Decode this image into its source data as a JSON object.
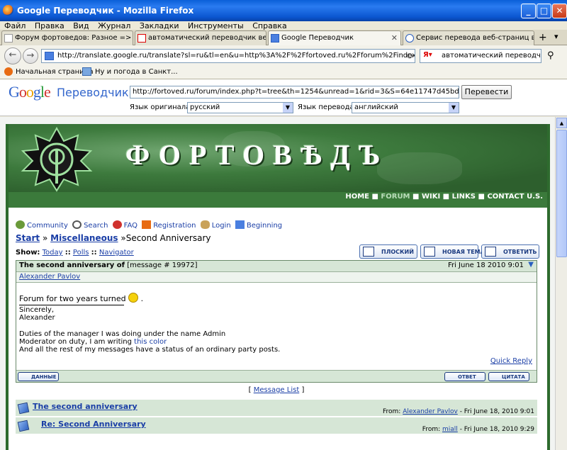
{
  "window": {
    "title": "Google Переводчик - Mozilla Firefox",
    "min": "_",
    "max": "□",
    "close": "✕"
  },
  "menu": [
    "Файл",
    "Правка",
    "Вид",
    "Журнал",
    "Закладки",
    "Инструменты",
    "Справка"
  ],
  "tabs": [
    {
      "label": "Форум фортоведов: Разное => Вт..."
    },
    {
      "label": "автоматический переводчик веб ..."
    },
    {
      "label": "Google Переводчик"
    },
    {
      "label": "Сервис перевода веб-страниц в п..."
    }
  ],
  "new_tab": "+",
  "tab_list": "▾",
  "nav": {
    "back": "←",
    "forward": "→",
    "url": "http://translate.google.ru/translate?sl=ru&tl=en&u=http%3A%2F%2Ffortoved.ru%2Fforum%2Findex.php%3Ft",
    "search_text": "автоматический переводчик",
    "reload": "⟳"
  },
  "bookmarks": [
    "Начальная страница",
    "Ну и погода в Санкт..."
  ],
  "translate_bar": {
    "logo": "Google",
    "service": "Переводчик",
    "url": "http://fortoved.ru/forum/index.php?t=tree&th=1254&unread=1&rid=3&S=64e11747d45bd4e3c8ebc",
    "button": "Перевести",
    "source_label": "Язык оригинала:",
    "source_value": "русский",
    "target_label": "Язык перевода:",
    "target_value": "английский"
  },
  "site": {
    "title": "ФОРТОВѢДЪ",
    "nav": [
      "HOME",
      "FORUM",
      "WIKI",
      "LINKS",
      "CONTACT U.S."
    ],
    "tools": [
      "Community",
      "Search",
      "FAQ",
      "Registration",
      "Login",
      "Beginning"
    ],
    "breadcrumb": {
      "start": "Start",
      "sep1": "»",
      "section": "Miscellaneous",
      "sep2": "»",
      "current": "Second Anniversary"
    },
    "show": {
      "label": "Show:",
      "items": [
        "Today",
        "Polls",
        "Navigator"
      ],
      "sep": "::"
    },
    "actions": [
      "ПЛОСКИЙ",
      "НОВАЯ ТЕМА",
      "ОТВЕТИТЬ"
    ],
    "message": {
      "subject": "The second anniversary of",
      "number": "[message # 19972]",
      "date": "Fri June 18 2010 9:01",
      "author": "Alexander Pavlov",
      "line1": "Forum for two years turned",
      "line1_end": ".",
      "line2": "Sincerely,",
      "line3": "Alexander",
      "line4": "Duties of the manager I was doing under the name Admin",
      "line5_pre": "Moderator on duty, I am writing",
      "line5_link": "this color",
      "line6": "And all the rest of my messages have a status of an ordinary party posts.",
      "quick_reply": "Quick Reply",
      "btn_data": "ДАННЫЕ",
      "btn_reply": "ОТВЕТ",
      "btn_quote": "ЦИТАТА"
    },
    "message_list": {
      "open": "[",
      "link": "Message List",
      "close": "]"
    },
    "list": [
      {
        "title": "The second anniversary",
        "from_label": "From:",
        "from": "Alexander Pavlov",
        "date": "- Fri June 18, 2010 9:01"
      },
      {
        "title": "Re: Second Anniversary",
        "from_label": "From:",
        "from": "miall",
        "date": "- Fri June 18, 2010 9:29"
      }
    ]
  }
}
